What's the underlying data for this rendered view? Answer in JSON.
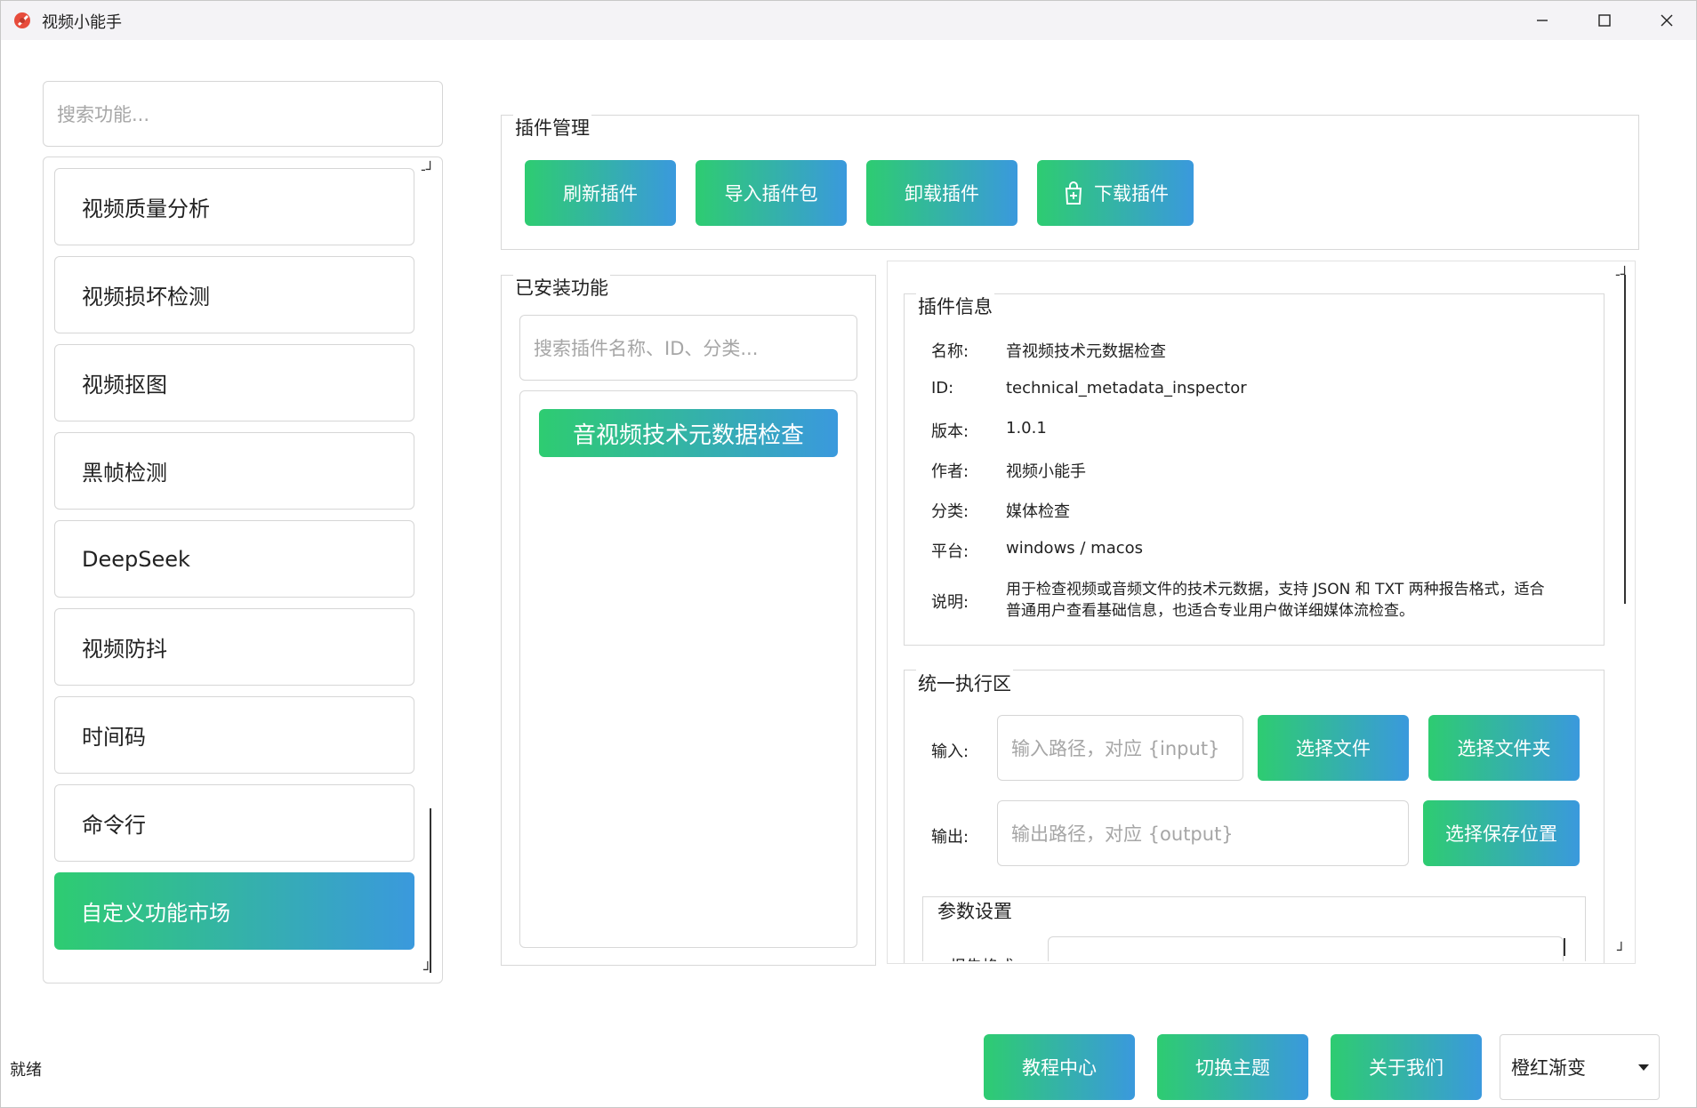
{
  "window": {
    "title": "视频小能手",
    "controls": {
      "minimize": "—",
      "maximize": "☐",
      "close": "✕"
    }
  },
  "sidebar": {
    "search_placeholder": "搜索功能...",
    "items": [
      {
        "label": "视频质量分析"
      },
      {
        "label": "视频损坏检测"
      },
      {
        "label": "视频抠图"
      },
      {
        "label": "黑帧检测"
      },
      {
        "label": "DeepSeek"
      },
      {
        "label": "视频防抖"
      },
      {
        "label": "时间码"
      },
      {
        "label": "命令行"
      },
      {
        "label": "自定义功能市场",
        "active": true
      }
    ]
  },
  "plugin_manager": {
    "title": "插件管理",
    "buttons": {
      "refresh": "刷新插件",
      "import": "导入插件包",
      "uninstall": "卸载插件",
      "download": "下载插件"
    }
  },
  "installed": {
    "title": "已安装功能",
    "search_placeholder": "搜索插件名称、ID、分类...",
    "items": [
      {
        "label": "音视频技术元数据检查"
      }
    ]
  },
  "plugin_info": {
    "title": "插件信息",
    "rows": {
      "name": {
        "label": "名称:",
        "value": "音视频技术元数据检查"
      },
      "id": {
        "label": "ID:",
        "value": "technical_metadata_inspector"
      },
      "version": {
        "label": "版本:",
        "value": "1.0.1"
      },
      "author": {
        "label": "作者:",
        "value": "视频小能手"
      },
      "category": {
        "label": "分类:",
        "value": "媒体检查"
      },
      "platform": {
        "label": "平台:",
        "value": "windows / macos"
      },
      "description": {
        "label": "说明:",
        "line1": "用于检查视频或音频文件的技术元数据，支持 JSON 和 TXT 两种报告格式，适合",
        "line2": "普通用户查看基础信息，也适合专业用户做详细媒体流检查。"
      }
    }
  },
  "exec": {
    "title": "统一执行区",
    "input_label": "输入:",
    "input_placeholder": "输入路径，对应 {input}",
    "choose_file": "选择文件",
    "choose_folder": "选择文件夹",
    "output_label": "输出:",
    "output_placeholder": "输出路径，对应 {output}",
    "choose_save": "选择保存位置",
    "params_title": "参数设置",
    "params_partial_label": "报告格式"
  },
  "footer": {
    "status": "就绪",
    "tutorial": "教程中心",
    "switch_theme": "切换主题",
    "about": "关于我们",
    "theme_select": "橙红渐变"
  },
  "colors": {
    "gradient_start": "#2ecc71",
    "gradient_end": "#3a99dd",
    "border": "#d6d6d6",
    "placeholder": "#a6a6a6"
  }
}
